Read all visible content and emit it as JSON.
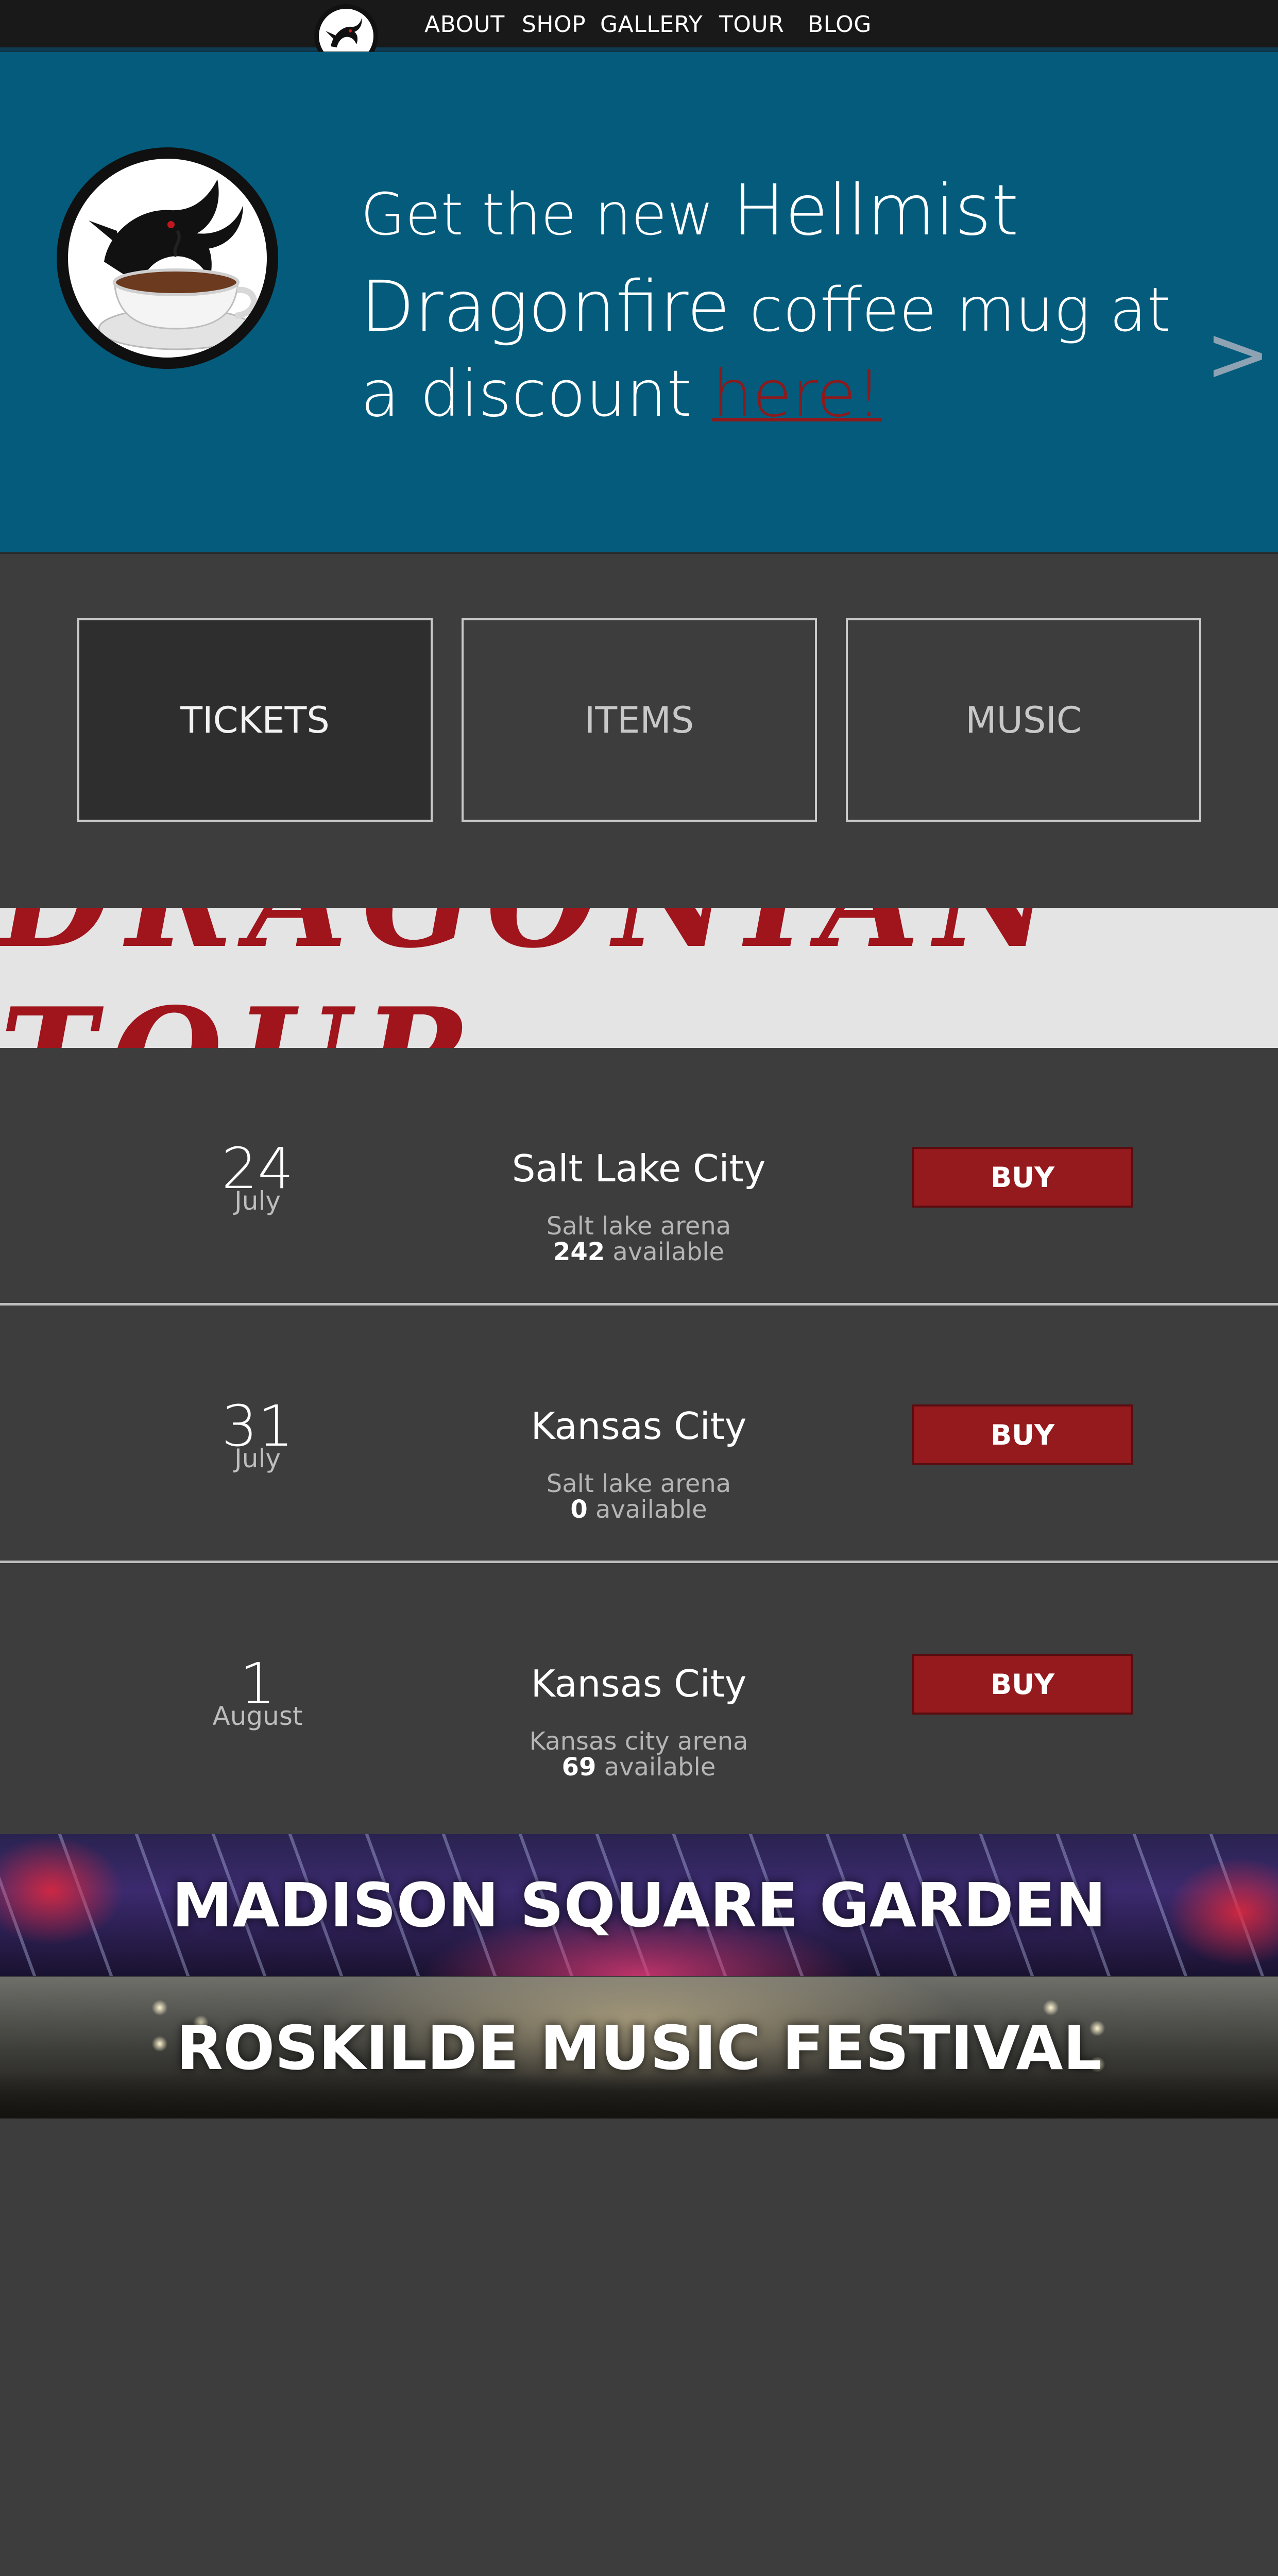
{
  "nav": {
    "links": [
      "ABOUT",
      "SHOP",
      "GALLERY",
      "TOUR",
      "BLOG"
    ]
  },
  "hero": {
    "line1_a": "Get the new ",
    "line1_b": "Hellmist",
    "line2_a": "Dragonfire",
    "line2_b": " coffee mug at",
    "line3_a": "a discount ",
    "link_text": "here!",
    "next_arrow": ">"
  },
  "categories": [
    {
      "label": "TICKETS",
      "active": true
    },
    {
      "label": "ITEMS",
      "active": false
    },
    {
      "label": "MUSIC",
      "active": false
    }
  ],
  "tour": {
    "title": "DRAGONIAN TOUR"
  },
  "events": [
    {
      "day": "24",
      "month": "July",
      "city": "Salt Lake City",
      "venue": "Salt lake arena",
      "count": "242",
      "avail_suffix": " available",
      "buy": "BUY"
    },
    {
      "day": "31",
      "month": "July",
      "city": "Kansas City",
      "venue": "Salt lake arena",
      "count": "0",
      "avail_suffix": " available",
      "buy": "BUY"
    },
    {
      "day": "1",
      "month": "August",
      "city": "Kansas City",
      "venue": "Kansas city arena",
      "count": "69",
      "avail_suffix": " available",
      "buy": "BUY"
    }
  ],
  "venues": [
    {
      "label": "MADISON SQUARE GARDEN"
    },
    {
      "label": "ROSKILDE MUSIC FESTIVAL"
    }
  ],
  "colors": {
    "background": "#3d3d3d",
    "navbar": "#191919",
    "hero": "#045b7b",
    "accent_red": "#941a1d",
    "link_red": "#8c1a1d"
  }
}
